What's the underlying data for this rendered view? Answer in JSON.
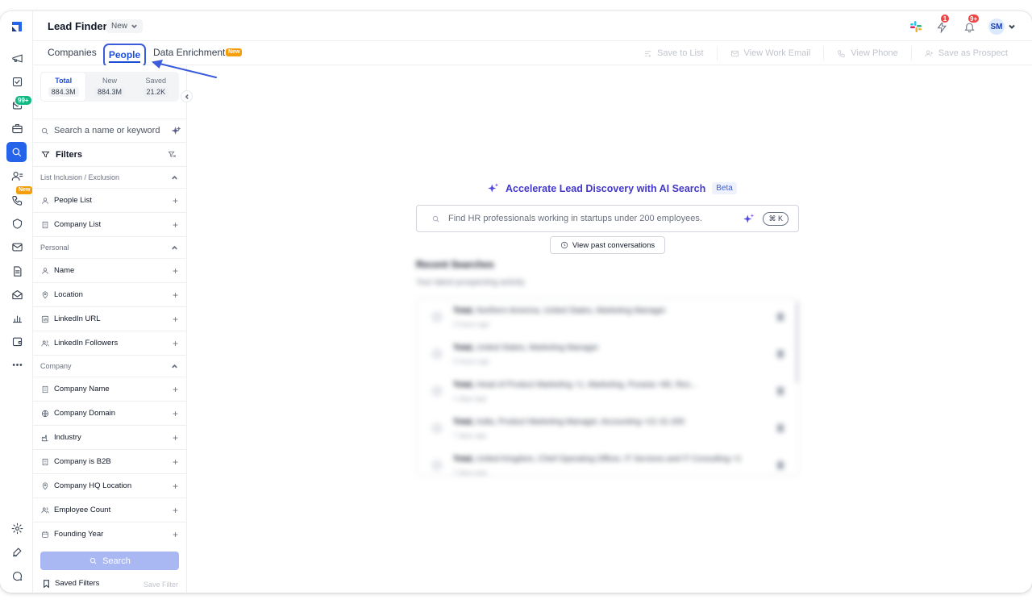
{
  "header": {
    "app_title": "Lead Finder",
    "view_dropdown": "New",
    "lightning_badge": "1",
    "notification_badge": "9+",
    "user_initials": "SM"
  },
  "rail": {
    "inbox_badge": "99+",
    "dialer_badge": "New"
  },
  "tabs": [
    {
      "label": "Companies"
    },
    {
      "label": "People",
      "active": true
    },
    {
      "label": "Data Enrichment",
      "badge": "New"
    }
  ],
  "actions": {
    "save_to_list": "Save to List",
    "view_work_email": "View Work Email",
    "view_phone": "View Phone",
    "save_as_prospect": "Save as Prospect"
  },
  "stats": [
    {
      "label": "Total",
      "value": "884.3M",
      "active": true
    },
    {
      "label": "New",
      "value": "884.3M"
    },
    {
      "label": "Saved",
      "value": "21.2K"
    }
  ],
  "filter_panel": {
    "search_placeholder": "Search a name or keyword",
    "filters_heading": "Filters",
    "sections": [
      {
        "title": "List Inclusion / Exclusion",
        "items": [
          {
            "label": "People List",
            "icon": "person-icon"
          },
          {
            "label": "Company List",
            "icon": "building-icon"
          }
        ]
      },
      {
        "title": "Personal",
        "items": [
          {
            "label": "Name",
            "icon": "person-icon"
          },
          {
            "label": "Location",
            "icon": "pin-icon"
          },
          {
            "label": "LinkedIn URL",
            "icon": "linkedin-icon"
          },
          {
            "label": "LinkedIn Followers",
            "icon": "people-icon"
          }
        ]
      },
      {
        "title": "Company",
        "items": [
          {
            "label": "Company Name",
            "icon": "building-icon"
          },
          {
            "label": "Company Domain",
            "icon": "globe-icon"
          },
          {
            "label": "Industry",
            "icon": "factory-icon"
          },
          {
            "label": "Company is B2B",
            "icon": "building-icon"
          },
          {
            "label": "Company HQ Location",
            "icon": "pin-icon"
          },
          {
            "label": "Employee Count",
            "icon": "people-icon"
          },
          {
            "label": "Founding Year",
            "icon": "calendar-icon"
          }
        ]
      }
    ],
    "search_button": "Search",
    "saved_filters": "Saved Filters",
    "save_filter": "Save Filter"
  },
  "ai_search": {
    "title": "Accelerate Lead Discovery with AI Search",
    "beta": "Beta",
    "placeholder": "Find HR professionals working in startups under 200 employees.",
    "shortcut": "⌘ K",
    "past_conversations": "View past conversations"
  },
  "recent": {
    "title": "Recent Searches",
    "subtitle": "Your latest prospecting activity",
    "items": [
      {
        "label": "Total,",
        "query": "Northern America, United States, Marketing Manager",
        "time": "2 hours ago"
      },
      {
        "label": "Total,",
        "query": "United States, Marketing Manager",
        "time": "2 hours ago"
      },
      {
        "label": "Total,",
        "query": "Head of Product Marketing +1, Marketing, Purasia +80, Res...",
        "time": "1 days ago"
      },
      {
        "label": "Total,",
        "query": "India, Product Marketing Manager, Accounting +21 31-200",
        "time": "7 days ago"
      },
      {
        "label": "Total,",
        "query": "United Kingdom, Chief Operating Officer, IT Services and IT Consulting +1",
        "time": "7 days ago"
      }
    ]
  },
  "colors": {
    "primary": "#2563eb",
    "accent_purple": "#4338ca",
    "badge_red": "#ef4444",
    "badge_green": "#10b981",
    "badge_orange": "#f59e0b",
    "search_button_disabled": "#a9b8f3"
  }
}
